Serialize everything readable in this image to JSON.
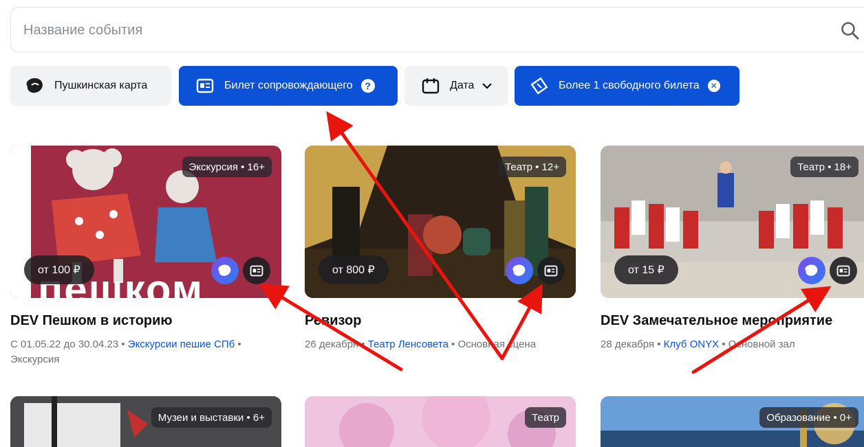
{
  "search": {
    "placeholder": "Название события",
    "icon": "search-icon"
  },
  "filters": {
    "pushkin_card": {
      "label": "Пушкинская карта",
      "icon": "pushkin-card-icon"
    },
    "companion_ticket": {
      "label": "Билет сопровождающего",
      "icon": "ticket-card-icon",
      "help_icon": "question-circle-icon",
      "active": true
    },
    "date": {
      "label": "Дата",
      "icon": "calendar-icon",
      "chevron_icon": "chevron-down-icon"
    },
    "free_tickets": {
      "label": "Более 1 свободного билета",
      "icon": "ticket-icon",
      "clear_icon": "close-circle-icon",
      "active": true
    }
  },
  "colors": {
    "accent": "#0b52d6",
    "chip_bg": "#f1f2f4",
    "annotation_arrow": "#e8150e"
  },
  "events": [
    {
      "title": "DEV Пешком в историю",
      "badge": "Экскурсия • 16+",
      "price": "от 100 ₽",
      "image_text": "пешком",
      "meta_prefix": "С 01.05.22 до 30.04.23 • ",
      "meta_link": "Экскурсии пешие СПб",
      "meta_suffix": " •",
      "meta_line2": "Экскурсия"
    },
    {
      "title": "Ревизор",
      "badge": "Театр • 12+",
      "price": "от 800 ₽",
      "meta_prefix": "26 декабря • ",
      "meta_link": "Театр Ленсовета",
      "meta_suffix": " • Основная сцена"
    },
    {
      "title": "DEV Замечательное мероприятие",
      "badge": "Театр • 18+",
      "price": "от 15 ₽",
      "meta_prefix": "28 декабря • ",
      "meta_link": "Клуб ONYX",
      "meta_suffix": " • Основной зал"
    },
    {
      "badge": "Музеи и выставки • 6+"
    },
    {
      "badge": "Театр"
    },
    {
      "badge": "Образование • 0+"
    }
  ]
}
